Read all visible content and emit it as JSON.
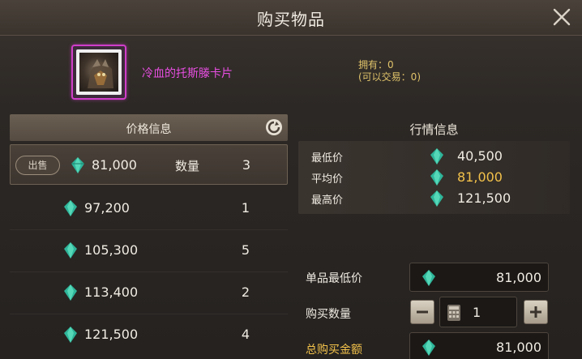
{
  "window": {
    "title": "购买物品",
    "close_icon": "close-icon"
  },
  "item": {
    "name": "冷血的托斯滕卡片",
    "owned_line": "拥有：0",
    "tradeable_line": "(可以交易：0)",
    "name_color": "#e64ee0",
    "frame_color": "#d03ec9"
  },
  "price_panel": {
    "header": "价格信息",
    "refresh_icon": "refresh-icon",
    "sell_label": "出售",
    "qty_label": "数量",
    "rows": [
      {
        "price": "81,000",
        "qty": "3"
      },
      {
        "price": "97,200",
        "qty": "1"
      },
      {
        "price": "105,300",
        "qty": "5"
      },
      {
        "price": "113,400",
        "qty": "2"
      },
      {
        "price": "121,500",
        "qty": "4"
      }
    ]
  },
  "market_panel": {
    "header": "行情信息",
    "lowest_label": "最低价",
    "lowest_value": "40,500",
    "average_label": "平均价",
    "average_value": "81,000",
    "highest_label": "最高价",
    "highest_value": "121,500",
    "average_color": "#f2c14a"
  },
  "purchase": {
    "unit_min_label": "单品最低价",
    "unit_min_value": "81,000",
    "qty_label": "购买数量",
    "qty_value": "1",
    "total_label": "总购买金额",
    "total_value": "81,000",
    "total_label_color": "#f2c14a"
  },
  "icons": {
    "currency": "gem-icon",
    "calculator": "calculator-icon",
    "minus": "minus-icon",
    "plus": "plus-icon"
  }
}
